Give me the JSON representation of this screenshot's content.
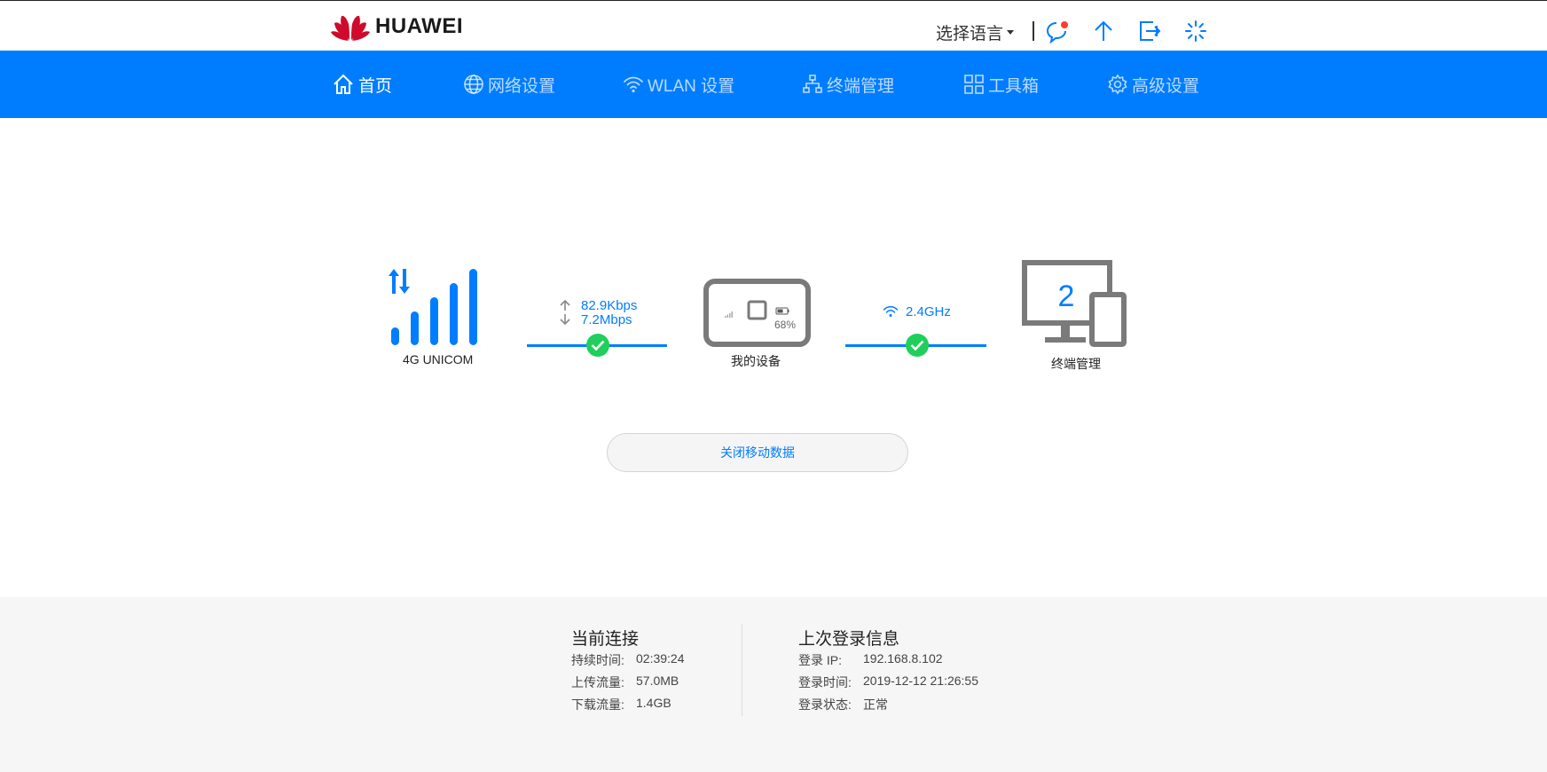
{
  "header": {
    "brand": "HUAWEI",
    "language_label": "选择语言",
    "icons": [
      "message-icon",
      "update-icon",
      "logout-icon",
      "loading-icon"
    ]
  },
  "nav": {
    "items": [
      {
        "label": "首页",
        "icon": "home-icon",
        "active": true
      },
      {
        "label": "网络设置",
        "icon": "globe-icon",
        "active": false
      },
      {
        "label": "WLAN 设置",
        "icon": "wifi-icon",
        "active": false
      },
      {
        "label": "终端管理",
        "icon": "network-tree-icon",
        "active": false
      },
      {
        "label": "工具箱",
        "icon": "toolbox-icon",
        "active": false
      },
      {
        "label": "高级设置",
        "icon": "gear-icon",
        "active": false
      }
    ]
  },
  "status": {
    "network_label": "4G  UNICOM",
    "upload_speed": "82.9Kbps",
    "download_speed": "7.2Mbps",
    "device_label": "我的设备",
    "battery": "68%",
    "wifi_band": "2.4GHz",
    "client_count": "2",
    "terminal_label": "终端管理",
    "toggle_data_button": "关闭移动数据"
  },
  "colors": {
    "primary": "#007dff",
    "ok_green": "#1fcf5a",
    "device_gray": "#7a7a7a"
  },
  "footer": {
    "current": {
      "title": "当前连接",
      "rows": [
        {
          "label": "持续时间:",
          "value": "02:39:24"
        },
        {
          "label": "上传流量:",
          "value": "57.0MB"
        },
        {
          "label": "下载流量:",
          "value": "1.4GB"
        }
      ]
    },
    "last_login": {
      "title": "上次登录信息",
      "rows": [
        {
          "label": "登录 IP:",
          "value": "192.168.8.102"
        },
        {
          "label": "登录时间:",
          "value": "2019-12-12 21:26:55"
        },
        {
          "label": "登录状态:",
          "value": "正常"
        }
      ]
    }
  }
}
